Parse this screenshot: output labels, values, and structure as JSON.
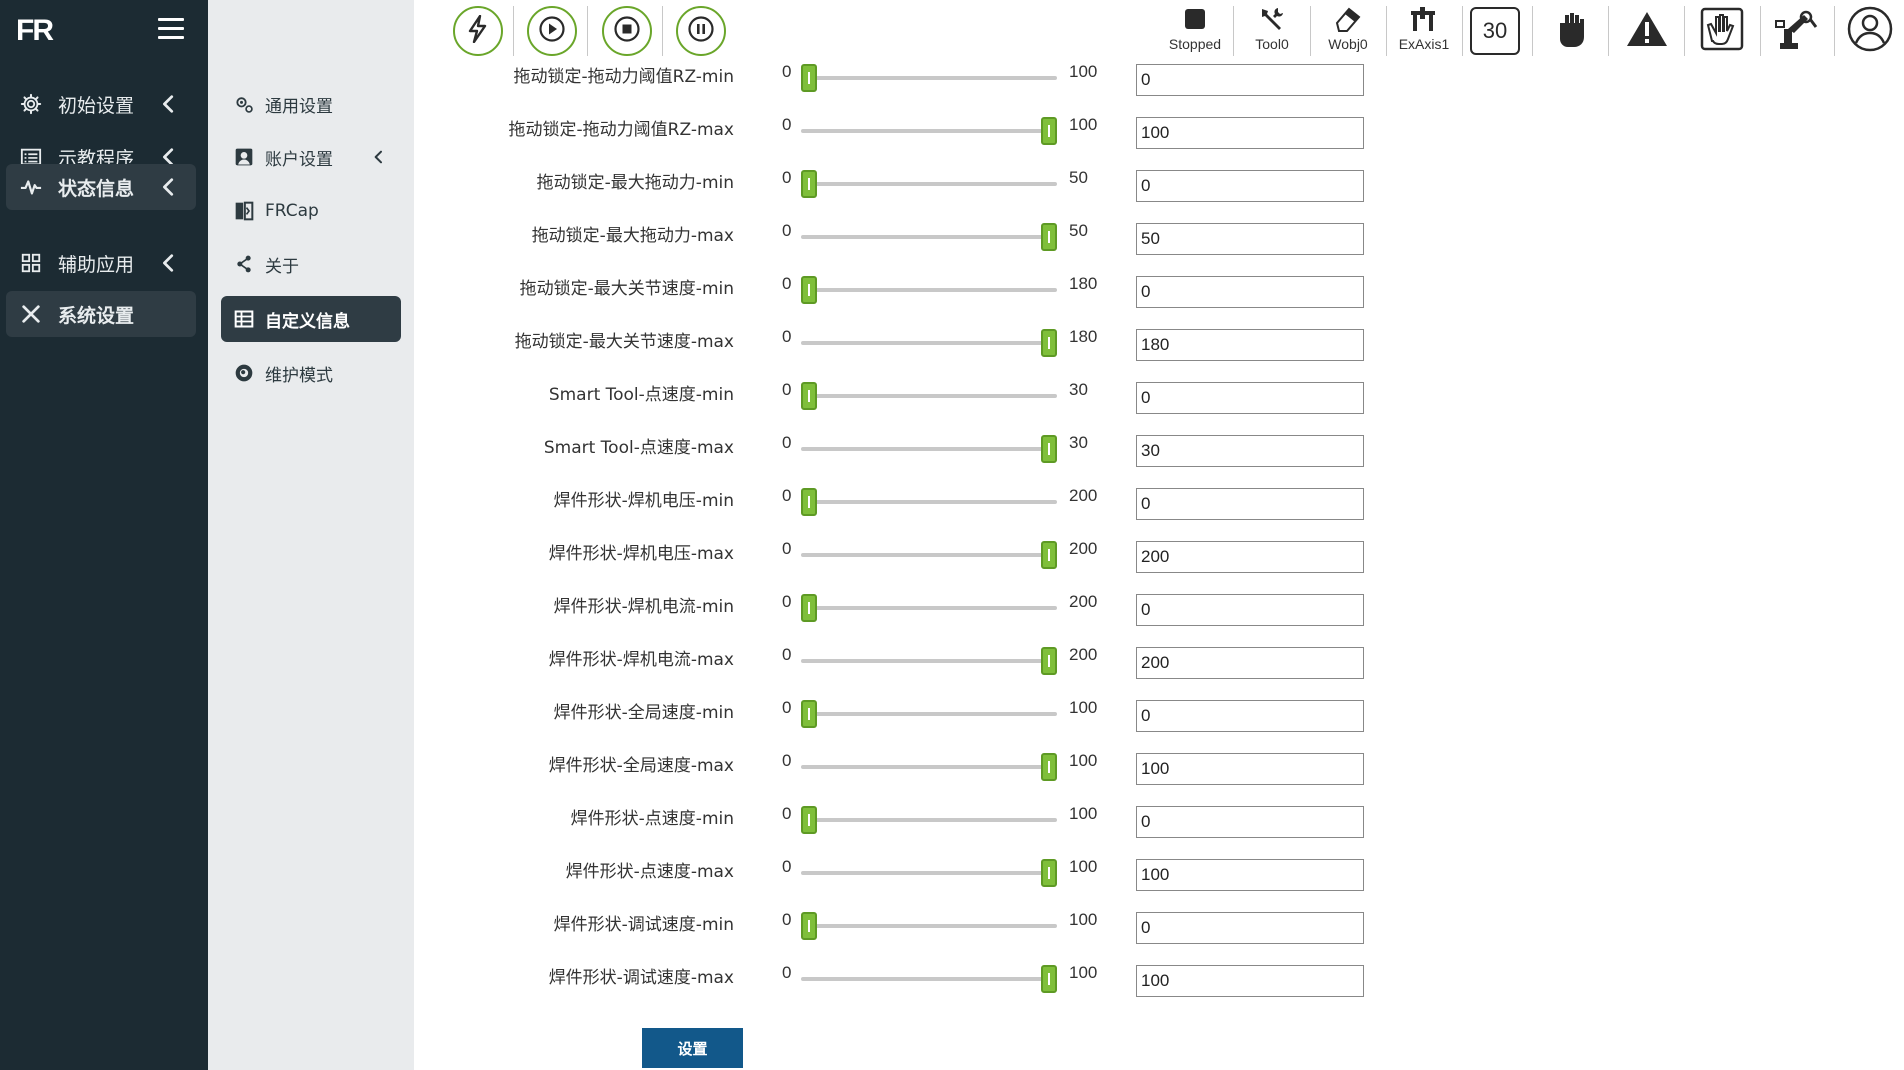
{
  "colors": {
    "sidebar_bg": "#1c2b33",
    "accent_green": "#6aa62a",
    "slider_green": "#7fbf3a",
    "button_blue": "#12588a"
  },
  "sidebar": {
    "logo": "FR",
    "items": [
      {
        "label": "初始设置",
        "icon": "gear-icon",
        "active": false
      },
      {
        "label": "示教程序",
        "icon": "list-icon",
        "active": false
      },
      {
        "label": "状态信息",
        "icon": "pulse-icon",
        "active": true
      },
      {
        "label": "辅助应用",
        "icon": "grid-icon",
        "active": false
      },
      {
        "label": "系统设置",
        "icon": "tools-icon",
        "active": true
      }
    ]
  },
  "subnav": {
    "items": [
      {
        "label": "通用设置",
        "icon": "gears-icon"
      },
      {
        "label": "账户设置",
        "icon": "account-icon"
      },
      {
        "label": "FRCap",
        "icon": "frcap-icon"
      },
      {
        "label": "关于",
        "icon": "share-icon"
      },
      {
        "label": "自定义信息",
        "icon": "table-icon",
        "active": true
      },
      {
        "label": "维护模式",
        "icon": "maintenance-icon"
      }
    ]
  },
  "toolbar": {
    "buttons": [
      "lightning",
      "play",
      "stop",
      "pause"
    ],
    "status": [
      {
        "label": "Stopped",
        "icon": "stopped-square-icon"
      },
      {
        "label": "Tool0",
        "icon": "wrench-icon"
      },
      {
        "label": "Wobj0",
        "icon": "eraser-icon"
      },
      {
        "label": "ExAxis1",
        "icon": "ex-axis-icon"
      }
    ],
    "speed": "30"
  },
  "params": [
    {
      "label": "拖动锁定-拖动力阈值RZ-min",
      "min": "0",
      "max": "100",
      "value": "0",
      "fraction": 0
    },
    {
      "label": "拖动锁定-拖动力阈值RZ-max",
      "min": "0",
      "max": "100",
      "value": "100",
      "fraction": 1
    },
    {
      "label": "拖动锁定-最大拖动力-min",
      "min": "0",
      "max": "50",
      "value": "0",
      "fraction": 0
    },
    {
      "label": "拖动锁定-最大拖动力-max",
      "min": "0",
      "max": "50",
      "value": "50",
      "fraction": 1
    },
    {
      "label": "拖动锁定-最大关节速度-min",
      "min": "0",
      "max": "180",
      "value": "0",
      "fraction": 0
    },
    {
      "label": "拖动锁定-最大关节速度-max",
      "min": "0",
      "max": "180",
      "value": "180",
      "fraction": 1
    },
    {
      "label": "Smart Tool-点速度-min",
      "min": "0",
      "max": "30",
      "value": "0",
      "fraction": 0
    },
    {
      "label": "Smart Tool-点速度-max",
      "min": "0",
      "max": "30",
      "value": "30",
      "fraction": 1
    },
    {
      "label": "焊件形状-焊机电压-min",
      "min": "0",
      "max": "200",
      "value": "0",
      "fraction": 0
    },
    {
      "label": "焊件形状-焊机电压-max",
      "min": "0",
      "max": "200",
      "value": "200",
      "fraction": 1
    },
    {
      "label": "焊件形状-焊机电流-min",
      "min": "0",
      "max": "200",
      "value": "0",
      "fraction": 0
    },
    {
      "label": "焊件形状-焊机电流-max",
      "min": "0",
      "max": "200",
      "value": "200",
      "fraction": 1
    },
    {
      "label": "焊件形状-全局速度-min",
      "min": "0",
      "max": "100",
      "value": "0",
      "fraction": 0
    },
    {
      "label": "焊件形状-全局速度-max",
      "min": "0",
      "max": "100",
      "value": "100",
      "fraction": 1
    },
    {
      "label": "焊件形状-点速度-min",
      "min": "0",
      "max": "100",
      "value": "0",
      "fraction": 0
    },
    {
      "label": "焊件形状-点速度-max",
      "min": "0",
      "max": "100",
      "value": "100",
      "fraction": 1
    },
    {
      "label": "焊件形状-调试速度-min",
      "min": "0",
      "max": "100",
      "value": "0",
      "fraction": 0
    },
    {
      "label": "焊件形状-调试速度-max",
      "min": "0",
      "max": "100",
      "value": "100",
      "fraction": 1
    }
  ],
  "actions": {
    "set_label": "设置"
  }
}
